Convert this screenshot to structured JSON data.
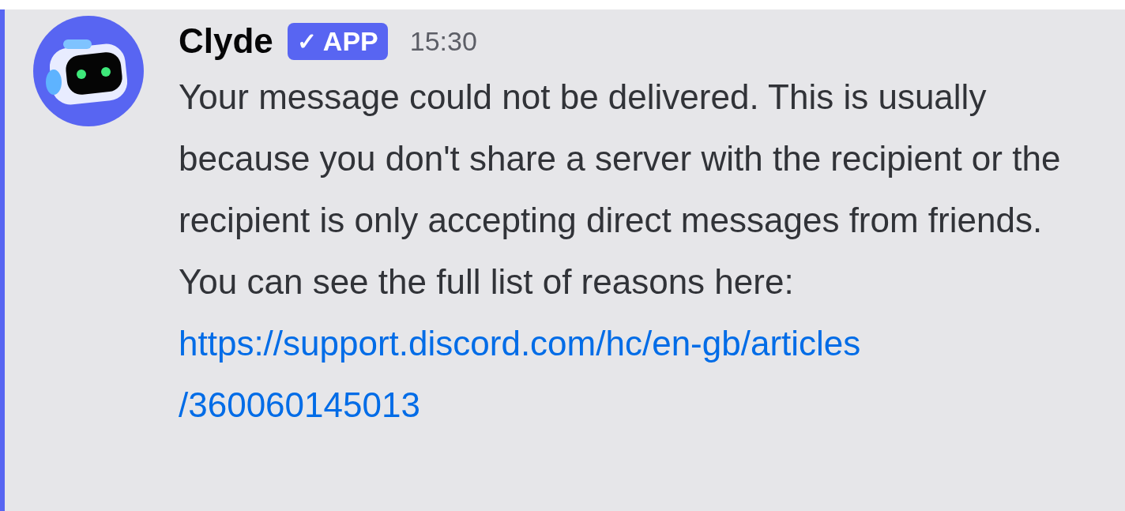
{
  "message": {
    "author": "Clyde",
    "badge": {
      "check": "✓",
      "label": "APP"
    },
    "time": "15:30",
    "highlighted": true,
    "text": "Your message could not be delivered. This is usually because you don't share a server with the recipient or the recipient is only accepting direct messages from friends. You can see the full list of reasons here:",
    "link_lines": [
      "https://support.discord.com/hc/en-gb/articles",
      "/360060145013"
    ]
  }
}
